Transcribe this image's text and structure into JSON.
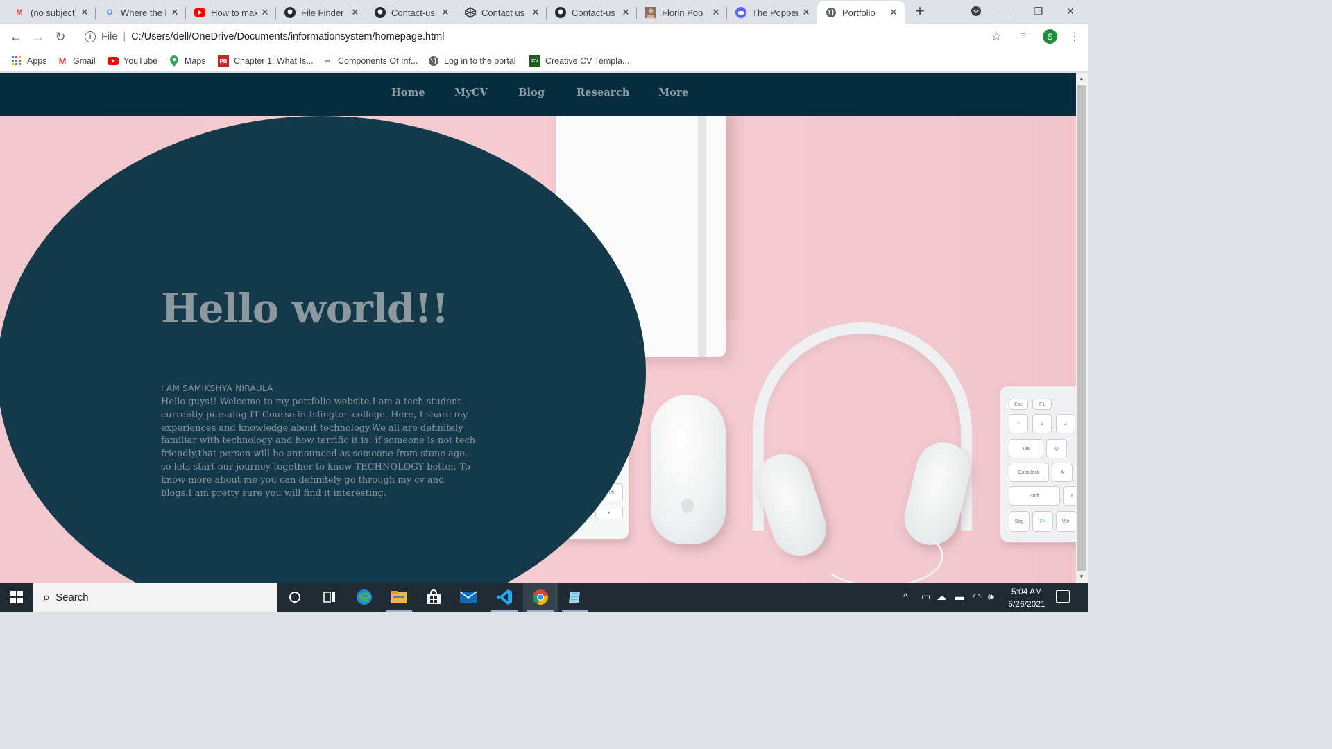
{
  "browser": {
    "tabs": [
      {
        "title": "(no subject)",
        "icon": "gmail-icon",
        "color": "#ea4335"
      },
      {
        "title": "Where the l",
        "icon": "google-icon",
        "color": "#4285f4"
      },
      {
        "title": "How to mak",
        "icon": "youtube-icon",
        "color": "#ff0000"
      },
      {
        "title": "File Finder",
        "icon": "github-icon",
        "color": "#24292e"
      },
      {
        "title": "Contact-us",
        "icon": "github-icon",
        "color": "#24292e"
      },
      {
        "title": "Contact us",
        "icon": "codepen-icon",
        "color": "#202124"
      },
      {
        "title": "Contact-us",
        "icon": "github-icon",
        "color": "#24292e"
      },
      {
        "title": "Florin Pop",
        "icon": "person-icon",
        "color": "#8d6e63"
      },
      {
        "title": "The Popper",
        "icon": "discord-icon",
        "color": "#5865f2"
      },
      {
        "title": "Portfolio",
        "icon": "globe-icon",
        "color": "#5f6368",
        "active": true
      }
    ],
    "address": {
      "scheme": "File",
      "url": "C:/Users/dell/OneDrive/Documents/informationsystem/homepage.html"
    },
    "profile_initial": "S",
    "bookmarks": [
      {
        "label": "Apps",
        "icon": "apps-grid-icon"
      },
      {
        "label": "Gmail",
        "icon": "gmail-icon"
      },
      {
        "label": "YouTube",
        "icon": "youtube-icon"
      },
      {
        "label": "Maps",
        "icon": "maps-icon"
      },
      {
        "label": "Chapter 1: What Is...",
        "icon": "pb-icon"
      },
      {
        "label": "Components Of Inf...",
        "icon": "gg-icon"
      },
      {
        "label": "Log in to the portal",
        "icon": "globe-icon"
      },
      {
        "label": "Creative CV Templa...",
        "icon": "cv-icon"
      }
    ]
  },
  "site": {
    "nav": [
      "Home",
      "MyCV",
      "Blog",
      "Research",
      "More"
    ],
    "hero": {
      "heading": "Hello world!!",
      "name": "I AM SAMIKSHYA NIRAULA",
      "body_lines": [
        "Hello guys!! Welcome to my portfolio website.I am a tech student",
        "currently pursuing IT Course in Islington college. Here, I share my",
        "experiences and knowledge about technology.We all are definitely",
        "familiar with technology and how terrific it is! if someone is not tech",
        "friendly,that person will be announced as someone from stone age.",
        "so lets start our journey together to know TECHNOLOGY better. To",
        "know more about me you can definitely go through my cv and",
        "blogs.I am pretty sure you will find it interesting."
      ]
    },
    "colors": {
      "nav_bg": "#052d3e",
      "blob": "#14394a",
      "text_muted": "#8b989e",
      "background_pink": "#f2c9cf"
    },
    "keyboard_keys": [
      "Tab",
      "Caps lock",
      "Shift",
      "Strg",
      "Fn",
      "Win",
      "A",
      "Q",
      "Y",
      "Esc",
      "F1",
      "1",
      "2"
    ],
    "keyboard_left_keys": [
      "Shift"
    ]
  },
  "taskbar": {
    "search_placeholder": "Search",
    "apps": [
      "cortana-icon",
      "task-view-icon",
      "edge-icon",
      "file-explorer-icon",
      "store-icon",
      "mail-icon",
      "vscode-icon",
      "chrome-icon",
      "notepad-icon"
    ],
    "time": "5:04 AM",
    "date": "5/26/2021"
  }
}
